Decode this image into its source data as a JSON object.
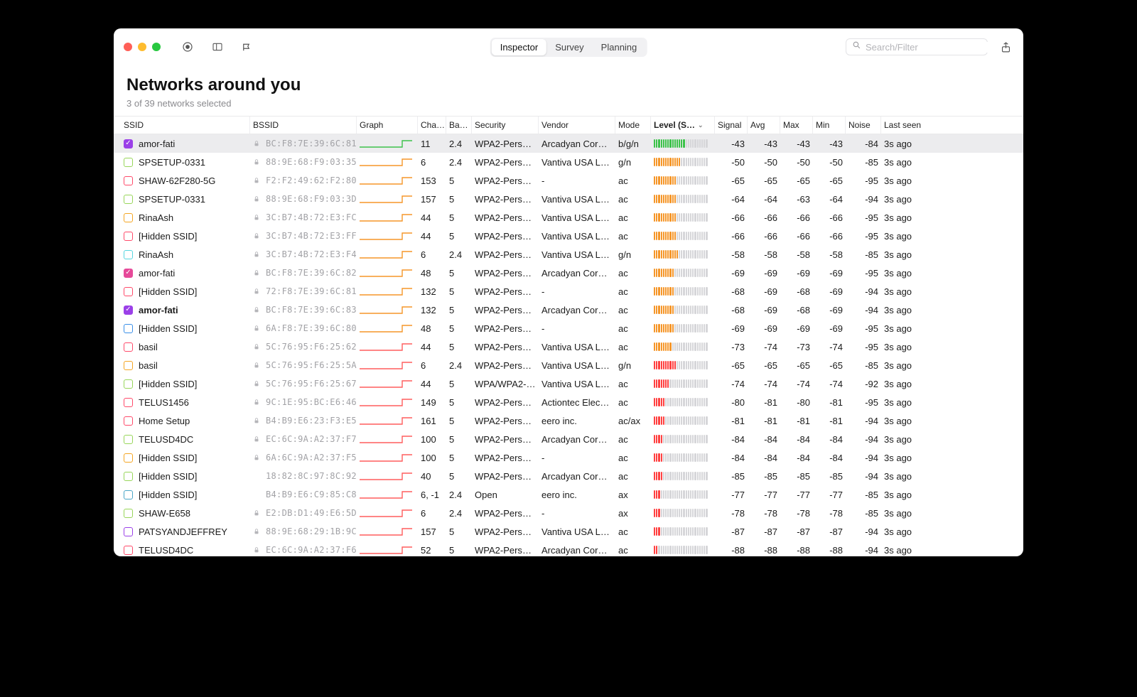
{
  "toolbar": {
    "tabs": [
      "Inspector",
      "Survey",
      "Planning"
    ],
    "search_placeholder": "Search/Filter"
  },
  "header": {
    "title": "Networks around you",
    "subtitle": "3 of 39 networks selected"
  },
  "columns": [
    "SSID",
    "BSSID",
    "Graph",
    "Cha…",
    "Ba…",
    "Security",
    "Vendor",
    "Mode",
    "Level (S…",
    "Signal",
    "Avg",
    "Max",
    "Min",
    "Noise",
    "Last seen"
  ],
  "sort_col_idx": 8,
  "rows": [
    {
      "checked": true,
      "bold": false,
      "sel": true,
      "color": "#9b40e8",
      "ssid": "amor-fati",
      "locked": true,
      "bssid": "BC:F8:7E:39:6C:81",
      "graphColor": "#3cc24a",
      "channel": "11",
      "band": "2.4",
      "security": "WPA2-Perso…",
      "vendor": "Arcadyan Cor…",
      "mode": "b/g/n",
      "barColor": "#3cc24a",
      "activeBars": 14,
      "signal": -43,
      "avg": -43,
      "max": -43,
      "min": -43,
      "noise": -84,
      "last": "3s ago"
    },
    {
      "checked": false,
      "bold": false,
      "sel": false,
      "color": "#98d65a",
      "ssid": "SPSETUP-0331",
      "locked": true,
      "bssid": "88:9E:68:F9:03:35",
      "graphColor": "#f59629",
      "channel": "6",
      "band": "2.4",
      "security": "WPA2-Perso…",
      "vendor": "Vantiva USA L…",
      "mode": "g/n",
      "barColor": "#f59629",
      "activeBars": 12,
      "signal": -50,
      "avg": -50,
      "max": -50,
      "min": -50,
      "noise": -85,
      "last": "3s ago"
    },
    {
      "checked": false,
      "bold": false,
      "sel": false,
      "color": "#ff4a6a",
      "ssid": "SHAW-62F280-5G",
      "locked": true,
      "bssid": "F2:F2:49:62:F2:80",
      "graphColor": "#f59629",
      "channel": "153",
      "band": "5",
      "security": "WPA2-Perso…",
      "vendor": "-",
      "mode": "ac",
      "barColor": "#f59629",
      "activeBars": 10,
      "signal": -65,
      "avg": -65,
      "max": -65,
      "min": -65,
      "noise": -95,
      "last": "3s ago"
    },
    {
      "checked": false,
      "bold": false,
      "sel": false,
      "color": "#98d65a",
      "ssid": "SPSETUP-0331",
      "locked": true,
      "bssid": "88:9E:68:F9:03:3D",
      "graphColor": "#f59629",
      "channel": "157",
      "band": "5",
      "security": "WPA2-Perso…",
      "vendor": "Vantiva USA L…",
      "mode": "ac",
      "barColor": "#f59629",
      "activeBars": 10,
      "signal": -64,
      "avg": -64,
      "max": -63,
      "min": -64,
      "noise": -94,
      "last": "3s ago"
    },
    {
      "checked": false,
      "bold": false,
      "sel": false,
      "color": "#f5a623",
      "ssid": "RinaAsh",
      "locked": true,
      "bssid": "3C:B7:4B:72:E3:FC",
      "graphColor": "#f59629",
      "channel": "44",
      "band": "5",
      "security": "WPA2-Perso…",
      "vendor": "Vantiva USA L…",
      "mode": "ac",
      "barColor": "#f59629",
      "activeBars": 10,
      "signal": -66,
      "avg": -66,
      "max": -66,
      "min": -66,
      "noise": -95,
      "last": "3s ago"
    },
    {
      "checked": false,
      "bold": false,
      "sel": false,
      "color": "#ff4a6a",
      "ssid": "[Hidden SSID]",
      "locked": true,
      "bssid": "3C:B7:4B:72:E3:FF",
      "graphColor": "#f59629",
      "channel": "44",
      "band": "5",
      "security": "WPA2-Perso…",
      "vendor": "Vantiva USA L…",
      "mode": "ac",
      "barColor": "#f59629",
      "activeBars": 10,
      "signal": -66,
      "avg": -66,
      "max": -66,
      "min": -66,
      "noise": -95,
      "last": "3s ago"
    },
    {
      "checked": false,
      "bold": false,
      "sel": false,
      "color": "#57d6e0",
      "ssid": "RinaAsh",
      "locked": true,
      "bssid": "3C:B7:4B:72:E3:F4",
      "graphColor": "#f59629",
      "channel": "6",
      "band": "2.4",
      "security": "WPA2-Perso…",
      "vendor": "Vantiva USA L…",
      "mode": "g/n",
      "barColor": "#f59629",
      "activeBars": 11,
      "signal": -58,
      "avg": -58,
      "max": -58,
      "min": -58,
      "noise": -85,
      "last": "3s ago"
    },
    {
      "checked": true,
      "bold": false,
      "sel": false,
      "color": "#e64a9a",
      "ssid": "amor-fati",
      "locked": true,
      "bssid": "BC:F8:7E:39:6C:82",
      "graphColor": "#f59629",
      "channel": "48",
      "band": "5",
      "security": "WPA2-Perso…",
      "vendor": "Arcadyan Cor…",
      "mode": "ac",
      "barColor": "#f59629",
      "activeBars": 9,
      "signal": -69,
      "avg": -69,
      "max": -69,
      "min": -69,
      "noise": -95,
      "last": "3s ago"
    },
    {
      "checked": false,
      "bold": false,
      "sel": false,
      "color": "#ff4a6a",
      "ssid": "[Hidden SSID]",
      "locked": true,
      "bssid": "72:F8:7E:39:6C:81",
      "graphColor": "#f59629",
      "channel": "132",
      "band": "5",
      "security": "WPA2-Perso…",
      "vendor": "-",
      "mode": "ac",
      "barColor": "#f59629",
      "activeBars": 9,
      "signal": -68,
      "avg": -69,
      "max": -68,
      "min": -69,
      "noise": -94,
      "last": "3s ago"
    },
    {
      "checked": true,
      "bold": true,
      "sel": false,
      "color": "#9b40e8",
      "ssid": "amor-fati",
      "locked": true,
      "bssid": "BC:F8:7E:39:6C:83",
      "graphColor": "#f59629",
      "channel": "132",
      "band": "5",
      "security": "WPA2-Perso…",
      "vendor": "Arcadyan Cor…",
      "mode": "ac",
      "barColor": "#f59629",
      "activeBars": 9,
      "signal": -68,
      "avg": -69,
      "max": -68,
      "min": -69,
      "noise": -94,
      "last": "3s ago"
    },
    {
      "checked": false,
      "bold": false,
      "sel": false,
      "color": "#3a8fe8",
      "ssid": "[Hidden SSID]",
      "locked": true,
      "bssid": "6A:F8:7E:39:6C:80",
      "graphColor": "#f59629",
      "channel": "48",
      "band": "5",
      "security": "WPA2-Perso…",
      "vendor": "-",
      "mode": "ac",
      "barColor": "#f59629",
      "activeBars": 9,
      "signal": -69,
      "avg": -69,
      "max": -69,
      "min": -69,
      "noise": -95,
      "last": "3s ago"
    },
    {
      "checked": false,
      "bold": false,
      "sel": false,
      "color": "#ff4a6a",
      "ssid": "basil",
      "locked": true,
      "bssid": "5C:76:95:F6:25:62",
      "graphColor": "#ff5d5d",
      "channel": "44",
      "band": "5",
      "security": "WPA2-Perso…",
      "vendor": "Vantiva USA L…",
      "mode": "ac",
      "barColor": "#f59629",
      "activeBars": 8,
      "signal": -73,
      "avg": -74,
      "max": -73,
      "min": -74,
      "noise": -95,
      "last": "3s ago"
    },
    {
      "checked": false,
      "bold": false,
      "sel": false,
      "color": "#f5a623",
      "ssid": "basil",
      "locked": true,
      "bssid": "5C:76:95:F6:25:5A",
      "graphColor": "#ff5d5d",
      "channel": "6",
      "band": "2.4",
      "security": "WPA2-Perso…",
      "vendor": "Vantiva USA L…",
      "mode": "g/n",
      "barColor": "#ff4040",
      "activeBars": 10,
      "signal": -65,
      "avg": -65,
      "max": -65,
      "min": -65,
      "noise": -85,
      "last": "3s ago"
    },
    {
      "checked": false,
      "bold": false,
      "sel": false,
      "color": "#98d65a",
      "ssid": "[Hidden SSID]",
      "locked": true,
      "bssid": "5C:76:95:F6:25:67",
      "graphColor": "#ff5d5d",
      "channel": "44",
      "band": "5",
      "security": "WPA/WPA2-…",
      "vendor": "Vantiva USA L…",
      "mode": "ac",
      "barColor": "#ff4040",
      "activeBars": 7,
      "signal": -74,
      "avg": -74,
      "max": -74,
      "min": -74,
      "noise": -92,
      "last": "3s ago"
    },
    {
      "checked": false,
      "bold": false,
      "sel": false,
      "color": "#ff4a6a",
      "ssid": "TELUS1456",
      "locked": true,
      "bssid": "9C:1E:95:BC:E6:46",
      "graphColor": "#ff5d5d",
      "channel": "149",
      "band": "5",
      "security": "WPA2-Perso…",
      "vendor": "Actiontec Elec…",
      "mode": "ac",
      "barColor": "#ff4040",
      "activeBars": 5,
      "signal": -80,
      "avg": -81,
      "max": -80,
      "min": -81,
      "noise": -95,
      "last": "3s ago"
    },
    {
      "checked": false,
      "bold": false,
      "sel": false,
      "color": "#ff4a6a",
      "ssid": "Home Setup",
      "locked": true,
      "bssid": "B4:B9:E6:23:F3:E5",
      "graphColor": "#ff5d5d",
      "channel": "161",
      "band": "5",
      "security": "WPA2-Perso…",
      "vendor": "eero inc.",
      "mode": "ac/ax",
      "barColor": "#ff4040",
      "activeBars": 5,
      "signal": -81,
      "avg": -81,
      "max": -81,
      "min": -81,
      "noise": -94,
      "last": "3s ago"
    },
    {
      "checked": false,
      "bold": false,
      "sel": false,
      "color": "#98d65a",
      "ssid": "TELUSD4DC",
      "locked": true,
      "bssid": "EC:6C:9A:A2:37:F7",
      "graphColor": "#ff5d5d",
      "channel": "100",
      "band": "5",
      "security": "WPA2-Perso…",
      "vendor": "Arcadyan Cor…",
      "mode": "ac",
      "barColor": "#ff4040",
      "activeBars": 4,
      "signal": -84,
      "avg": -84,
      "max": -84,
      "min": -84,
      "noise": -94,
      "last": "3s ago"
    },
    {
      "checked": false,
      "bold": false,
      "sel": false,
      "color": "#f5a623",
      "ssid": "[Hidden SSID]",
      "locked": true,
      "bssid": "6A:6C:9A:A2:37:F5",
      "graphColor": "#ff5d5d",
      "channel": "100",
      "band": "5",
      "security": "WPA2-Perso…",
      "vendor": "-",
      "mode": "ac",
      "barColor": "#ff4040",
      "activeBars": 4,
      "signal": -84,
      "avg": -84,
      "max": -84,
      "min": -84,
      "noise": -94,
      "last": "3s ago"
    },
    {
      "checked": false,
      "bold": false,
      "sel": false,
      "color": "#98d65a",
      "ssid": "[Hidden SSID]",
      "locked": false,
      "bssid": "18:82:8C:97:8C:92",
      "graphColor": "#ff5d5d",
      "channel": "40",
      "band": "5",
      "security": "WPA2-Perso…",
      "vendor": "Arcadyan Cor…",
      "mode": "ac",
      "barColor": "#ff4040",
      "activeBars": 4,
      "signal": -85,
      "avg": -85,
      "max": -85,
      "min": -85,
      "noise": -94,
      "last": "3s ago"
    },
    {
      "checked": false,
      "bold": false,
      "sel": false,
      "color": "#4aa6c7",
      "ssid": "[Hidden SSID]",
      "locked": false,
      "bssid": "B4:B9:E6:C9:85:C8",
      "graphColor": "#ff5d5d",
      "channel": "6, -1",
      "band": "2.4",
      "security": "Open",
      "vendor": "eero inc.",
      "mode": "ax",
      "barColor": "#ff4040",
      "activeBars": 3,
      "signal": -77,
      "avg": -77,
      "max": -77,
      "min": -77,
      "noise": -85,
      "last": "3s ago"
    },
    {
      "checked": false,
      "bold": false,
      "sel": false,
      "color": "#98d65a",
      "ssid": "SHAW-E658",
      "locked": true,
      "bssid": "E2:DB:D1:49:E6:5D",
      "graphColor": "#ff5d5d",
      "channel": "6",
      "band": "2.4",
      "security": "WPA2-Perso…",
      "vendor": "-",
      "mode": "ax",
      "barColor": "#ff4040",
      "activeBars": 3,
      "signal": -78,
      "avg": -78,
      "max": -78,
      "min": -78,
      "noise": -85,
      "last": "3s ago"
    },
    {
      "checked": false,
      "bold": false,
      "sel": false,
      "color": "#9b40e8",
      "ssid": "PATSYANDJEFFREY",
      "locked": true,
      "bssid": "88:9E:68:29:1B:9C",
      "graphColor": "#ff5d5d",
      "channel": "157",
      "band": "5",
      "security": "WPA2-Perso…",
      "vendor": "Vantiva USA L…",
      "mode": "ac",
      "barColor": "#ff4040",
      "activeBars": 3,
      "signal": -87,
      "avg": -87,
      "max": -87,
      "min": -87,
      "noise": -94,
      "last": "3s ago"
    },
    {
      "checked": false,
      "bold": false,
      "sel": false,
      "color": "#ff4a6a",
      "ssid": "TELUSD4DC",
      "locked": true,
      "bssid": "EC:6C:9A:A2:37:F6",
      "graphColor": "#ff5d5d",
      "channel": "52",
      "band": "5",
      "security": "WPA2-Perso…",
      "vendor": "Arcadyan Cor…",
      "mode": "ac",
      "barColor": "#ff4040",
      "activeBars": 2,
      "signal": -88,
      "avg": -88,
      "max": -88,
      "min": -88,
      "noise": -94,
      "last": "3s ago"
    }
  ]
}
